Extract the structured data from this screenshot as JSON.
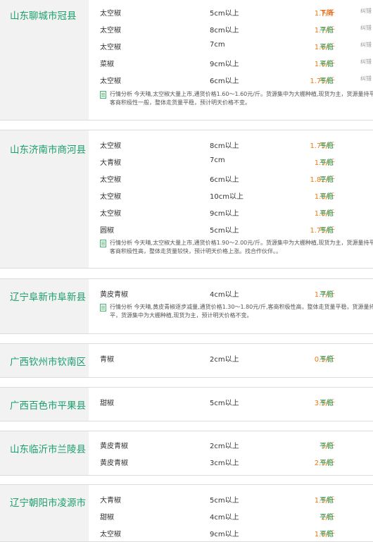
{
  "colors": {
    "location": "#1a9f6c",
    "price": "#f27a0a",
    "trend_stable": "#27a36e",
    "trend_down": "#e05a0a"
  },
  "markets": [
    {
      "location": "山东聊城市冠县",
      "items": [
        {
          "variety": "太空椒",
          "spec": "5cm以上",
          "price": "1.7/斤",
          "trend": "下降",
          "error": "纠错"
        },
        {
          "variety": "太空椒",
          "spec": "8cm以上",
          "price": "1.7/斤",
          "trend": "平稳",
          "error": "纠错"
        },
        {
          "variety": "太空椒",
          "spec": "7cm",
          "price": "1.6/斤",
          "trend": "平稳",
          "error": "纠错"
        },
        {
          "variety": "菜椒",
          "spec": "9cm以上",
          "price": "1.6/斤",
          "trend": "平稳",
          "error": "纠错"
        },
        {
          "variety": "太空椒",
          "spec": "6cm以上",
          "price": "1.75/斤",
          "trend": "平稳",
          "error": "纠错"
        }
      ],
      "analysis": "行情分析 今天晴,太空椒大量上市,通货价格1.60～1.60元/斤。货源集中为大棚种植,现货为主，货源量持平,客商积极性一般，整体走货量平稳，预计明天价格不变。"
    },
    {
      "location": "山东济南市商河县",
      "items": [
        {
          "variety": "太空椒",
          "spec": "8cm以上",
          "price": "1.75/斤",
          "trend": "平稳"
        },
        {
          "variety": "大青椒",
          "spec": "7cm",
          "price": "1.9/斤",
          "trend": "平稳"
        },
        {
          "variety": "太空椒",
          "spec": "6cm以上",
          "price": "1.82/斤",
          "trend": "平稳"
        },
        {
          "variety": "太空椒",
          "spec": "10cm以上",
          "price": "1.8/斤",
          "trend": "平稳"
        },
        {
          "variety": "太空椒",
          "spec": "9cm以上",
          "price": "1.8/斤",
          "trend": "平稳"
        },
        {
          "variety": "圆椒",
          "spec": "5cm以上",
          "price": "1.75/斤",
          "trend": "平稳"
        }
      ],
      "analysis": "行情分析 今天晴,太空椒大量上市,通货价格1.90～2.00元/斤。货源集中为大棚种植,现货为主，货源量持平,客商积极性高，整体走货量较快，预计明天价格上涨。找合作伙伴。。"
    },
    {
      "location": "辽宁阜新市阜新县",
      "items": [
        {
          "variety": "黄皮青椒",
          "spec": "4cm以上",
          "price": "1.7/斤",
          "trend": "平稳"
        }
      ],
      "analysis": "行情分析 今天晴,黄皮青椒逐步减量,通货价格1.30～1.80元/斤,客商积极性高，整体走货量平稳，货源量持平，货源集中为大棚种植,现货为主，预计明天价格不变。"
    },
    {
      "location": "广西钦州市钦南区",
      "items": [
        {
          "variety": "青椒",
          "spec": "2cm以上",
          "price": "0.5/斤",
          "trend": "平稳"
        }
      ]
    },
    {
      "location": "广西百色市平果县",
      "items": [
        {
          "variety": "甜椒",
          "spec": "5cm以上",
          "price": "3.5/斤",
          "trend": "平稳"
        }
      ]
    },
    {
      "location": "山东临沂市兰陵县",
      "items": [
        {
          "variety": "黄皮青椒",
          "spec": "2cm以上",
          "price": "3/斤",
          "trend": "平稳"
        },
        {
          "variety": "黄皮青椒",
          "spec": "3cm以上",
          "price": "2.9/斤",
          "trend": "平稳"
        }
      ]
    },
    {
      "location": "辽宁朝阳市凌源市",
      "items": [
        {
          "variety": "大青椒",
          "spec": "5cm以上",
          "price": "1.5/斤",
          "trend": "平稳"
        },
        {
          "variety": "甜椒",
          "spec": "4cm以上",
          "price": "2/斤",
          "trend": "平稳"
        },
        {
          "variety": "太空椒",
          "spec": "9cm以上",
          "price": "1.8/斤",
          "trend": "平稳"
        }
      ]
    }
  ]
}
